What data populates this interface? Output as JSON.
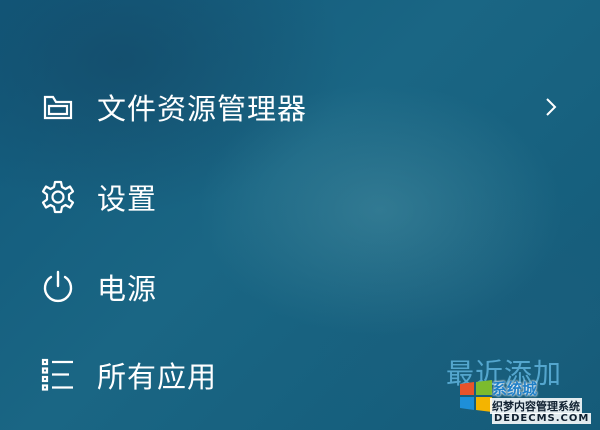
{
  "menu": {
    "items": [
      {
        "label": "文件资源管理器",
        "icon": "file-explorer-icon",
        "has_submenu": true
      },
      {
        "label": "设置",
        "icon": "gear-icon",
        "has_submenu": false
      },
      {
        "label": "电源",
        "icon": "power-icon",
        "has_submenu": false
      },
      {
        "label": "所有应用",
        "icon": "all-apps-list-icon",
        "has_submenu": false
      }
    ]
  },
  "recent_label": "最近添加",
  "watermark": {
    "line1": "系统城",
    "line2": "织梦内容管理系统",
    "line3": "DEDECMS.COM",
    "icon": "watermark-logo-icon"
  },
  "colors": {
    "background": "#175f7f",
    "text": "#ffffff",
    "recent_text": "#5fb3dd"
  }
}
